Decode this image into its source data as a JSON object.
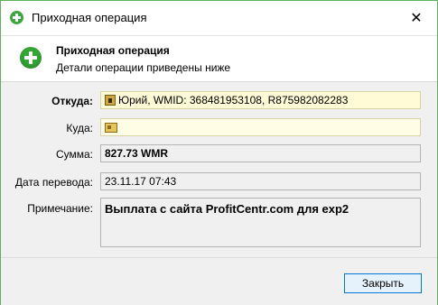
{
  "window": {
    "title": "Приходная операция",
    "close_glyph": "✕"
  },
  "header": {
    "title": "Приходная операция",
    "subtitle": "Детали операции приведены ниже"
  },
  "fields": {
    "from_label": "Откуда:",
    "from_value": "Юрий, WMID: 368481953108, R875982082283",
    "to_label": "Куда:",
    "to_value": "",
    "amount_label": "Сумма:",
    "amount_value": "827.73 WMR",
    "date_label": "Дата перевода:",
    "date_value": "23.11.17 07:43",
    "note_label": "Примечание:",
    "note_value": "Выплата с сайта ProfitCentr.com для exp2"
  },
  "footer": {
    "close_label": "Закрыть"
  },
  "icons": {
    "app": "plus-circle-icon",
    "header": "plus-circle-icon",
    "from": "webmoney-passport-icon",
    "to": "purse-card-icon"
  },
  "colors": {
    "accent_green": "#34a634",
    "button_border": "#0078d7",
    "yellow_field": "#fffbd6"
  }
}
